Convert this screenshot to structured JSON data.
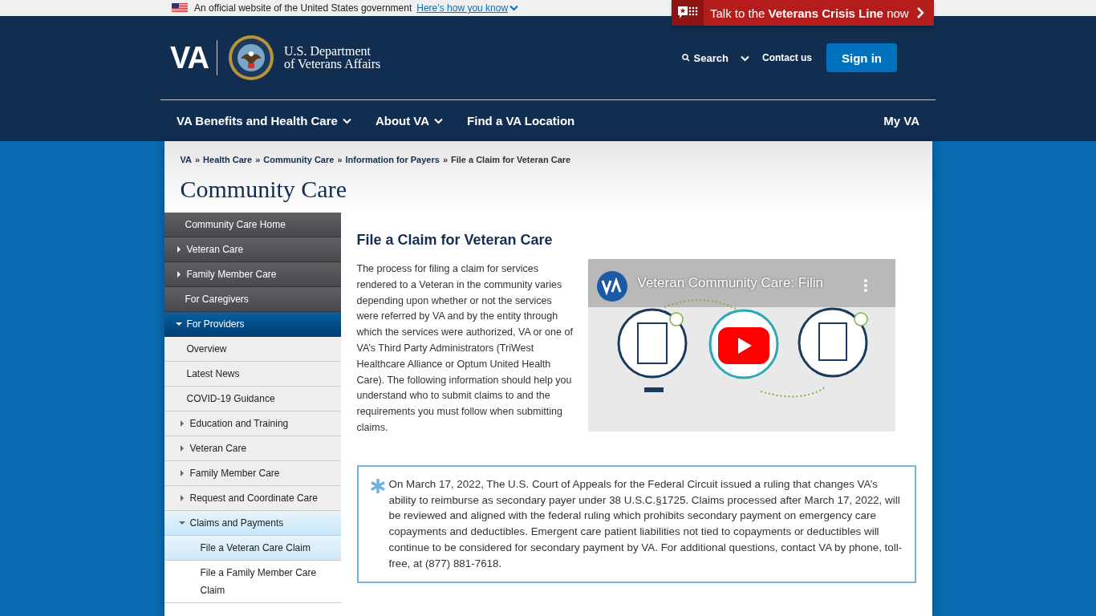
{
  "gov_banner": {
    "text": "An official website of the United States government",
    "link": "Here’s how you know"
  },
  "crisis_line": {
    "before": "Talk to the",
    "bold": "Veterans Crisis Line",
    "after": "now"
  },
  "header": {
    "logo_text": "VA",
    "agency_line_1": "U.S. Department",
    "agency_line_2": "of Veterans Affairs",
    "search": "Search",
    "contact": "Contact us",
    "sign_in": "Sign in"
  },
  "nav": {
    "items": [
      {
        "label": "VA Benefits and Health Care",
        "dropdown": true
      },
      {
        "label": "About VA",
        "dropdown": true
      },
      {
        "label": "Find a VA Location",
        "dropdown": false
      }
    ],
    "right": "My VA"
  },
  "breadcrumbs": {
    "separator": "»",
    "items": [
      "VA",
      "Health Care",
      "Community Care",
      "Information for Payers",
      "File a Claim for Veteran Care"
    ]
  },
  "page_title": "Community Care",
  "sidebar": {
    "items": [
      {
        "label": "Community Care Home",
        "selected": false
      },
      {
        "label": "Veteran Care",
        "expanded": false,
        "selected": false
      },
      {
        "label": "Family Member Care",
        "expanded": false,
        "selected": false
      },
      {
        "label": "For Caregivers",
        "selected": false
      },
      {
        "label": "For Providers",
        "expanded": true,
        "selected": true,
        "children": [
          {
            "label": "Overview",
            "selected": false
          },
          {
            "label": "Latest News",
            "selected": false
          },
          {
            "label": "COVID-19 Guidance",
            "selected": false
          },
          {
            "label": "Education and Training",
            "expanded": false,
            "selected": false
          },
          {
            "label": "Veteran Care",
            "expanded": false,
            "selected": false
          },
          {
            "label": "Family Member Care",
            "expanded": false,
            "selected": false
          },
          {
            "label": "Request and Coordinate Care",
            "expanded": false,
            "selected": false
          },
          {
            "label": "Claims and Payments",
            "expanded": true,
            "selected": true,
            "children": [
              {
                "label": "File a Veteran Care Claim",
                "selected": true
              },
              {
                "label": "File a Family Member Care Claim",
                "selected": false
              }
            ]
          }
        ]
      }
    ]
  },
  "article": {
    "heading": "File a Claim for Veteran Care",
    "intro": "The process for filing a claim for services rendered to a Veteran in the community varies depending upon whether or not the services were referred by VA and by the entity through which the services were authorized, VA or one of VA’s Third Party Administrators (TriWest Healthcare Alliance or Optum United Health Care). The following information should help you understand who to submit claims to and the requirements you must follow when submitting claims.",
    "video": {
      "kind": "picture",
      "title": "Veteran Community Care: Filin"
    },
    "notice": "On March 17, 2022, The U.S. Court of Appeals for the Federal Circuit issued a ruling that changes VA’s ability to reimburse as secondary payer under 38 U.S.C.§1725. Claims processed after March 17, 2022, will be reviewed and aligned with the federal ruling which prohibits secondary payment on emergency care copayments and deductibles. Emergent care patient liabilities not tied to copayments or deductibles will continue to be considered for secondary payment by VA. For additional questions, contact VA by phone, toll-free, at (877) 881-7618."
  }
}
